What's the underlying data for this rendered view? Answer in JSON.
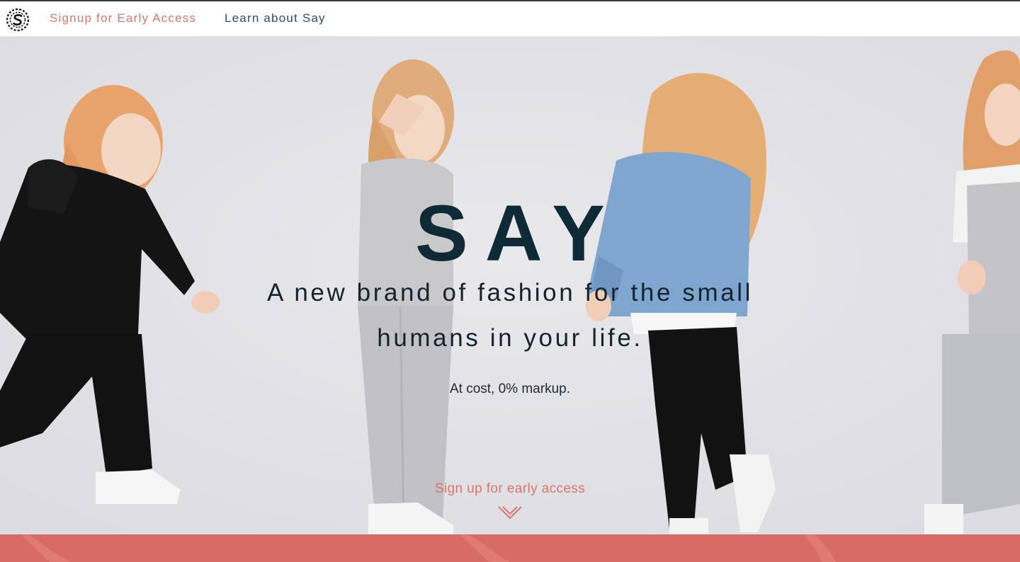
{
  "nav": {
    "signup_label": "Signup for Early Access",
    "learn_label": "Learn about Say"
  },
  "hero": {
    "brand": "SAY",
    "tagline": "A new brand of fashion for the small humans in your life.",
    "subtagline": "At cost, 0% markup.",
    "cta_label": "Sign up for early access"
  },
  "colors": {
    "accent_coral": "#d8766d",
    "navy": "#0f2a37",
    "nav_link_blue": "#2e4f63",
    "hero_bg": "#e4e4e8",
    "footer_band": "#d86b66"
  },
  "icons": {
    "logo": "say-logo-icon",
    "cta_arrow": "chevron-down-icon"
  }
}
